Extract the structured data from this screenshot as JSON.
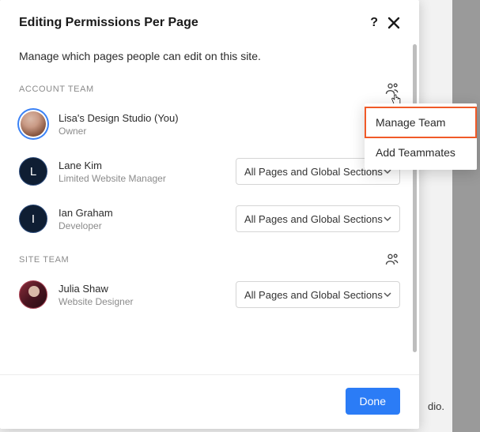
{
  "modal": {
    "title": "Editing Permissions Per Page",
    "subtitle": "Manage which pages people can edit on this site.",
    "footer": {
      "done": "Done"
    }
  },
  "account_team": {
    "label": "ACCOUNT TEAM",
    "members": [
      {
        "name": "Lisa's Design Studio (You)",
        "role": "Owner",
        "dropdown": null
      },
      {
        "name": "Lane Kim",
        "role": "Limited Website Manager",
        "initial": "L",
        "dropdown": "All Pages and Global Sections"
      },
      {
        "name": "Ian Graham",
        "role": "Developer",
        "initial": "I",
        "dropdown": "All Pages and Global Sections"
      }
    ]
  },
  "site_team": {
    "label": "SITE TEAM",
    "members": [
      {
        "name": "Julia Shaw",
        "role": "Website Designer",
        "dropdown": "All Pages and Global Sections"
      }
    ]
  },
  "popmenu": {
    "manage": "Manage Team",
    "add": "Add Teammates"
  },
  "backdrop_text": "dio."
}
